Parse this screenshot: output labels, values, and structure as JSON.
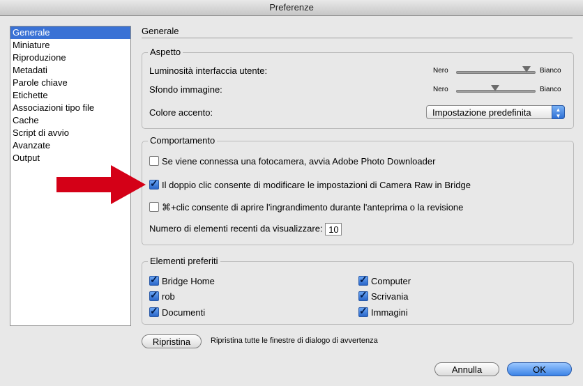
{
  "window": {
    "title": "Preferenze"
  },
  "sidebar": {
    "selected_index": 0,
    "items": [
      {
        "label": "Generale"
      },
      {
        "label": "Miniature"
      },
      {
        "label": "Riproduzione"
      },
      {
        "label": "Metadati"
      },
      {
        "label": "Parole chiave"
      },
      {
        "label": "Etichette"
      },
      {
        "label": "Associazioni tipo file"
      },
      {
        "label": "Cache"
      },
      {
        "label": "Script di avvio"
      },
      {
        "label": "Avanzate"
      },
      {
        "label": "Output"
      }
    ]
  },
  "content": {
    "title": "Generale"
  },
  "aspetto": {
    "label": "Aspetto",
    "luminosita": {
      "label": "Luminosità interfaccia utente:",
      "min_label": "Nero",
      "max_label": "Bianco",
      "value_fraction": 0.9
    },
    "sfondo": {
      "label": "Sfondo immagine:",
      "min_label": "Nero",
      "max_label": "Bianco",
      "value_fraction": 0.5
    },
    "colore_accento": {
      "label": "Colore accento:",
      "value": "Impostazione predefinita"
    }
  },
  "comportamento": {
    "label": "Comportamento",
    "options": [
      {
        "label": "Se viene connessa una fotocamera, avvia Adobe Photo Downloader",
        "checked": false
      },
      {
        "label": "Il doppio clic consente di modificare le impostazioni di Camera Raw in Bridge",
        "checked": true
      },
      {
        "label": "⌘+clic consente di aprire l'ingrandimento durante l'anteprima o la revisione",
        "checked": false
      }
    ],
    "recent": {
      "label": "Numero di elementi recenti da visualizzare:",
      "value": "10"
    }
  },
  "preferiti": {
    "label": "Elementi preferiti",
    "items": [
      {
        "label": "Bridge Home",
        "checked": true
      },
      {
        "label": "Computer",
        "checked": true
      },
      {
        "label": "rob",
        "checked": true
      },
      {
        "label": "Scrivania",
        "checked": true
      },
      {
        "label": "Documenti",
        "checked": true
      },
      {
        "label": "Immagini",
        "checked": true
      }
    ]
  },
  "reset": {
    "button_label": "Ripristina",
    "description": "Ripristina tutte le finestre di dialogo di avvertenza"
  },
  "footer": {
    "cancel_label": "Annulla",
    "ok_label": "OK"
  },
  "colors": {
    "selection": "#3a72d5",
    "arrow": "#d40017",
    "default_button": "#3b82e6"
  },
  "icons": {
    "annotation": "red-arrow-icon",
    "select_arrow": "up-down-arrows-icon",
    "checkbox": "checkmark-icon"
  }
}
